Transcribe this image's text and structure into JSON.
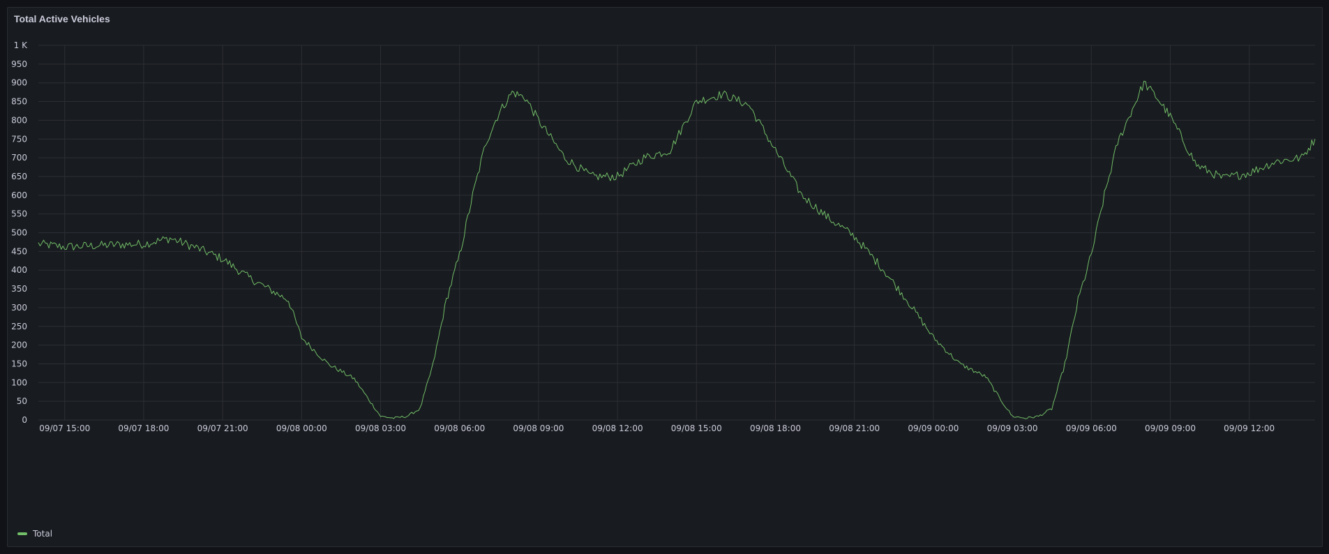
{
  "panel": {
    "title": "Total Active Vehicles"
  },
  "chart_data": {
    "type": "line",
    "title": "Total Active Vehicles",
    "xlabel": "",
    "ylabel": "",
    "ylim": [
      0,
      1000
    ],
    "y_ticks": [
      0,
      50,
      100,
      150,
      200,
      250,
      300,
      350,
      400,
      450,
      500,
      550,
      600,
      650,
      700,
      750,
      800,
      850,
      900,
      950,
      1000
    ],
    "y_tick_labels": [
      "0",
      "50",
      "100",
      "150",
      "200",
      "250",
      "300",
      "350",
      "400",
      "450",
      "500",
      "550",
      "600",
      "650",
      "700",
      "750",
      "800",
      "850",
      "900",
      "950",
      "1 K"
    ],
    "xlim": [
      "09/07 14:00",
      "09/09 14:30"
    ],
    "x_ticks": [
      "09/07 15:00",
      "09/07 18:00",
      "09/07 21:00",
      "09/08 00:00",
      "09/08 03:00",
      "09/08 06:00",
      "09/08 09:00",
      "09/08 12:00",
      "09/08 15:00",
      "09/08 18:00",
      "09/08 21:00",
      "09/09 00:00",
      "09/09 03:00",
      "09/09 06:00",
      "09/09 09:00",
      "09/09 12:00"
    ],
    "grid": true,
    "legend": "bottom-left",
    "colors": {
      "series": "#73bf69",
      "grid": "#2c2f35",
      "text": "#ccccdc"
    },
    "series": [
      {
        "name": "Total",
        "x": [
          "09/07 14:00",
          "09/07 15:00",
          "09/07 16:00",
          "09/07 17:00",
          "09/07 18:00",
          "09/07 19:00",
          "09/07 20:00",
          "09/07 21:00",
          "09/07 22:00",
          "09/07 23:00",
          "09/07 23:30",
          "09/08 00:00",
          "09/08 01:00",
          "09/08 02:00",
          "09/08 02:30",
          "09/08 03:00",
          "09/08 03:30",
          "09/08 04:00",
          "09/08 04:30",
          "09/08 05:00",
          "09/08 05:30",
          "09/08 06:00",
          "09/08 06:30",
          "09/08 07:00",
          "09/08 07:30",
          "09/08 08:00",
          "09/08 08:30",
          "09/08 09:00",
          "09/08 10:00",
          "09/08 11:00",
          "09/08 12:00",
          "09/08 13:00",
          "09/08 14:00",
          "09/08 15:00",
          "09/08 16:00",
          "09/08 17:00",
          "09/08 18:00",
          "09/08 19:00",
          "09/08 20:00",
          "09/08 21:00",
          "09/08 22:00",
          "09/08 23:00",
          "09/09 00:00",
          "09/09 01:00",
          "09/09 02:00",
          "09/09 02:30",
          "09/09 03:00",
          "09/09 03:30",
          "09/09 04:00",
          "09/09 04:30",
          "09/09 05:00",
          "09/09 05:30",
          "09/09 06:00",
          "09/09 06:30",
          "09/09 07:00",
          "09/09 07:30",
          "09/09 08:00",
          "09/09 08:30",
          "09/09 09:00",
          "09/09 10:00",
          "09/09 11:00",
          "09/09 12:00",
          "09/09 13:00",
          "09/09 14:00",
          "09/09 14:30"
        ],
        "values": [
          470,
          462,
          465,
          468,
          470,
          485,
          460,
          430,
          380,
          340,
          320,
          220,
          150,
          110,
          60,
          10,
          5,
          10,
          30,
          150,
          320,
          440,
          600,
          740,
          820,
          875,
          860,
          800,
          700,
          650,
          650,
          700,
          720,
          850,
          870,
          840,
          720,
          600,
          540,
          490,
          410,
          320,
          220,
          150,
          115,
          60,
          10,
          5,
          10,
          30,
          150,
          320,
          440,
          600,
          740,
          820,
          900,
          860,
          810,
          680,
          645,
          660,
          690,
          700,
          750
        ]
      }
    ]
  }
}
